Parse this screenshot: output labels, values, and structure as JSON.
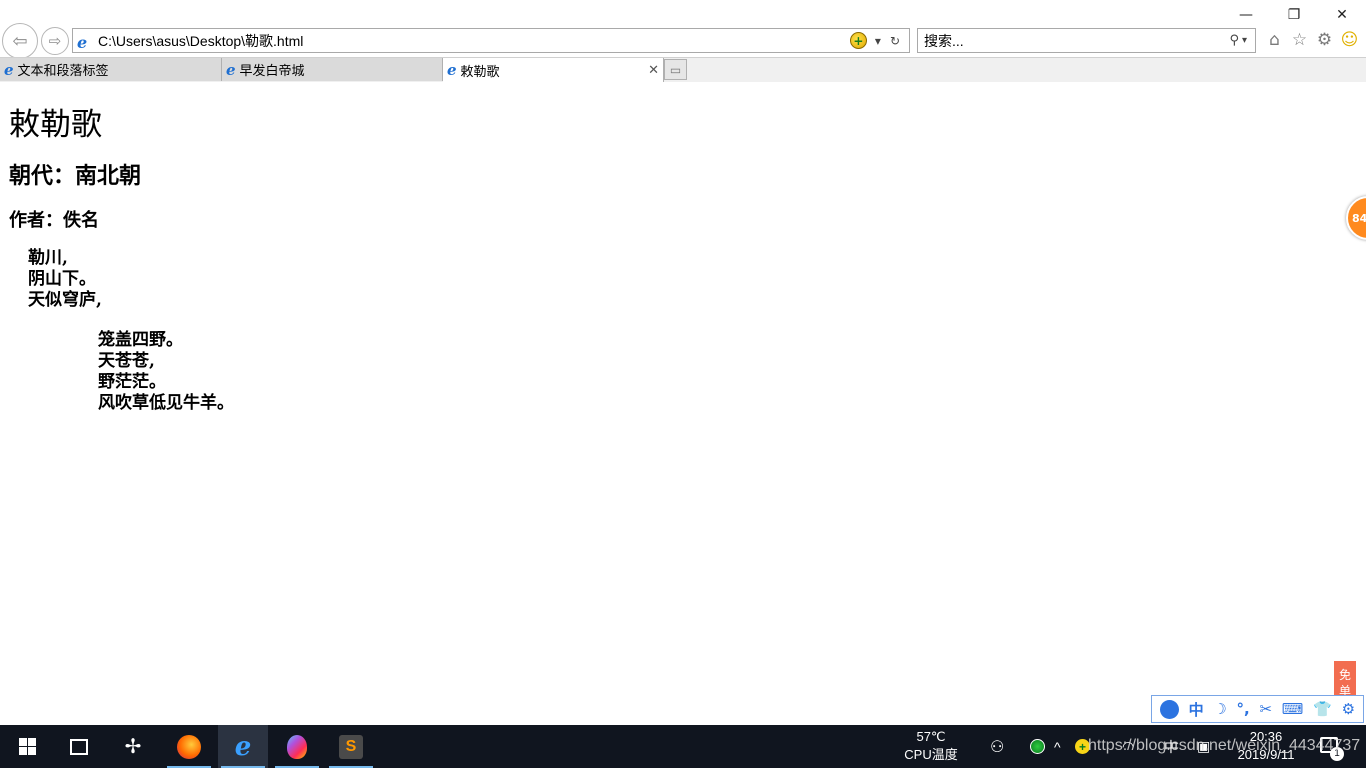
{
  "window": {
    "minimize_glyph": "—",
    "maximize_glyph": "❐",
    "close_glyph": "✕"
  },
  "navigation": {
    "back_glyph": "⇦",
    "forward_glyph": "⇨",
    "address": "C:\\Users\\asus\\Desktop\\勒歌.html",
    "compat_glyph": "+",
    "dropdown_glyph": "▾",
    "refresh_glyph": "↻",
    "search_placeholder": "搜索...",
    "search_glyph": "⚲",
    "search_dropdown_glyph": "▾"
  },
  "toolbar": {
    "home_glyph": "⌂",
    "favorites_glyph": "☆",
    "tools_glyph": "⚙",
    "feedback_glyph": "☺"
  },
  "tabs": [
    {
      "label": "文本和段落标签"
    },
    {
      "label": "早发白帝城"
    },
    {
      "label": "敕勒歌",
      "close_glyph": "✕"
    }
  ],
  "page": {
    "title": "敕勒歌",
    "dynasty": "朝代：南北朝",
    "author": "作者：佚名",
    "verse_part1": [
      "勒川,",
      "阴山下。",
      "天似穹庐,"
    ],
    "verse_part2": [
      "笼盖四野。",
      "天苍苍,",
      "野茫茫。",
      "风吹草低见牛羊。"
    ]
  },
  "overlays": {
    "float_ball_text": "84",
    "side_ad_text": "免单",
    "ime_items": [
      "中",
      "☽",
      "°,",
      "✂",
      "⌨",
      "👕",
      "⚙"
    ]
  },
  "taskbar": {
    "cpu_temp": "57℃",
    "cpu_label": "CPU温度",
    "ime_label": "中",
    "time": "20:36",
    "date": "2019/9/11",
    "notification_count": "1",
    "watermark": "https://blog.csdn.net/weixin_44344737"
  },
  "colors": {
    "taskbar_bg": "#10151f",
    "tab_active": "#ffffff",
    "tab_inactive": "#dadada",
    "ie_blue": "#1f6fd1"
  }
}
